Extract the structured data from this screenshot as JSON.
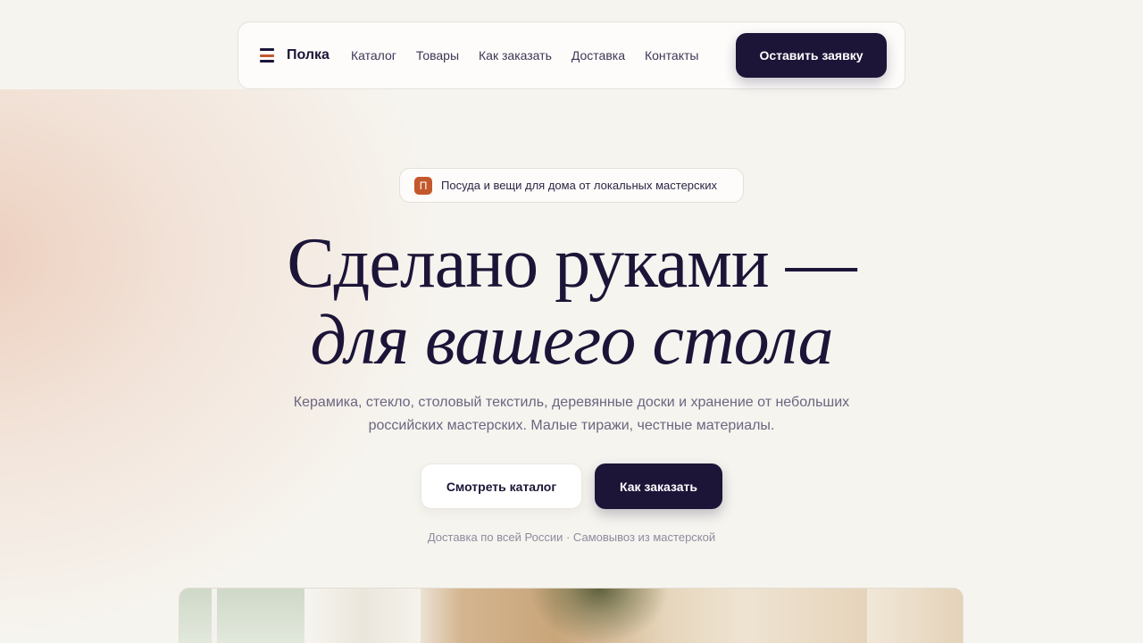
{
  "nav": {
    "brand": "Полка",
    "links": [
      "Каталог",
      "Товары",
      "Как заказать",
      "Доставка",
      "Контакты"
    ],
    "cta": "Оставить заявку"
  },
  "badge": {
    "icon_letter": "П",
    "text": "Посуда и вещи для дома от локальных мастерских"
  },
  "hero": {
    "title_line1": "Сделано руками —",
    "title_line2": "для вашего стола",
    "subtitle": "Керамика, стекло, столовый текстиль, деревянные доски и хранение от небольших российских мастерских. Малые тиражи, честные материалы.",
    "primary_button": "Смотреть каталог",
    "secondary_button": "Как заказать",
    "note": "Доставка по всей России · Самовывоз из мастерской"
  },
  "colors": {
    "background": "#f6f4ef",
    "ink": "#1c1538",
    "accent": "#c4582d"
  },
  "icons": {
    "brand": "stacked-shelf-icon"
  }
}
